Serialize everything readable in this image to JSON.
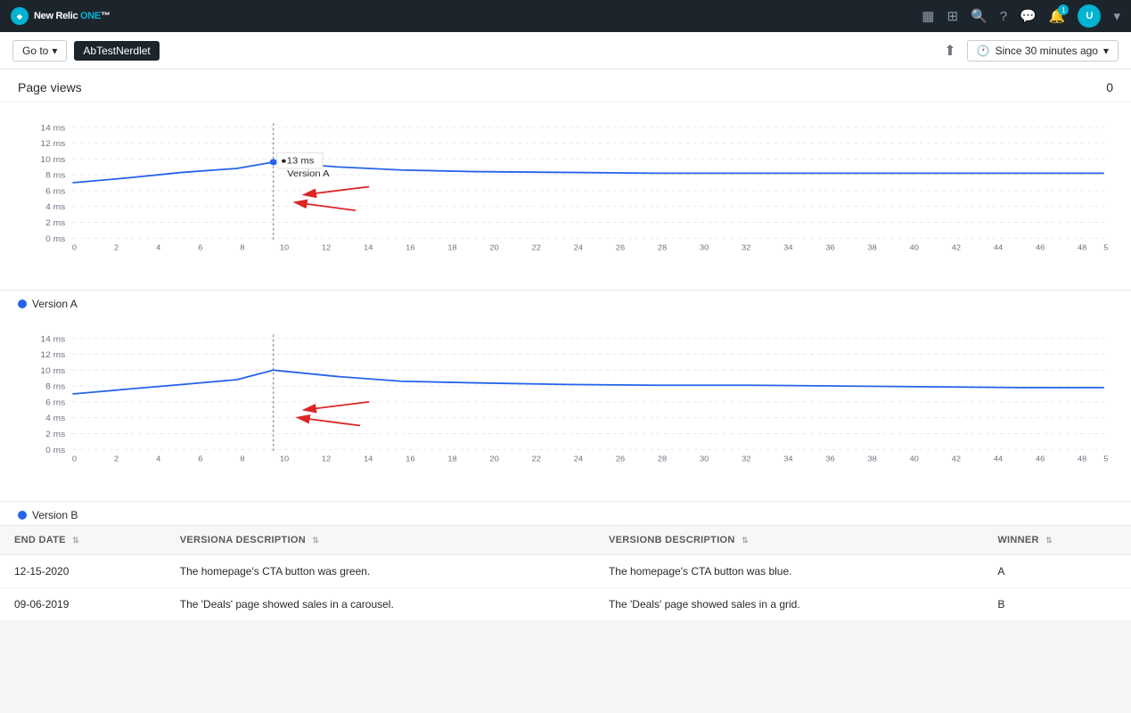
{
  "app": {
    "name": "New Relic ONE™"
  },
  "topnav": {
    "icons": [
      "chart-bar-icon",
      "grid-icon",
      "search-icon",
      "help-icon",
      "chat-icon",
      "bell-icon",
      "user-icon"
    ],
    "notification_count": "1",
    "user_initials": "U"
  },
  "breadcrumb": {
    "goto_label": "Go to",
    "goto_chevron": "▾",
    "nerdlet_label": "AbTestNerdlet",
    "share_icon": "↑",
    "time_icon": "🕐",
    "time_label": "Since 30 minutes ago",
    "time_chevron": "▾"
  },
  "pageviews": {
    "title": "Page views",
    "count": "0"
  },
  "chart1": {
    "legend_label": "Version A",
    "tooltip_value": "13 ms",
    "tooltip_label": "Version A",
    "y_labels": [
      "14 ms",
      "12 ms",
      "10 ms",
      "8 ms",
      "6 ms",
      "4 ms",
      "2 ms",
      "0 ms"
    ],
    "x_labels": [
      "0",
      "2",
      "4",
      "6",
      "8",
      "10",
      "12",
      "14",
      "16",
      "18",
      "20",
      "22",
      "24",
      "26",
      "28",
      "30",
      "32",
      "34",
      "36",
      "38",
      "40",
      "42",
      "44",
      "46",
      "48",
      "5"
    ]
  },
  "chart2": {
    "legend_label": "Version B",
    "y_labels": [
      "14 ms",
      "12 ms",
      "10 ms",
      "8 ms",
      "6 ms",
      "4 ms",
      "2 ms",
      "0 ms"
    ],
    "x_labels": [
      "0",
      "2",
      "4",
      "6",
      "8",
      "10",
      "12",
      "14",
      "16",
      "18",
      "20",
      "22",
      "24",
      "26",
      "28",
      "30",
      "32",
      "34",
      "36",
      "38",
      "40",
      "42",
      "44",
      "46",
      "48",
      "5"
    ]
  },
  "table": {
    "columns": [
      {
        "key": "end_date",
        "label": "END DATE"
      },
      {
        "key": "versiona_desc",
        "label": "VERSIONA DESCRIPTION"
      },
      {
        "key": "versionb_desc",
        "label": "VERSIONB DESCRIPTION"
      },
      {
        "key": "winner",
        "label": "WINNER"
      }
    ],
    "rows": [
      {
        "end_date": "12-15-2020",
        "versiona_desc": "The homepage's CTA button was green.",
        "versionb_desc": "The homepage's CTA button was blue.",
        "winner": "A"
      },
      {
        "end_date": "09-06-2019",
        "versiona_desc": "The 'Deals' page showed sales in a carousel.",
        "versionb_desc": "The 'Deals' page showed sales in a grid.",
        "winner": "B"
      }
    ]
  },
  "colors": {
    "version_a": "#2563eb",
    "version_b": "#2563eb",
    "legend_a": "#2563eb",
    "legend_b": "#2563eb",
    "arrow": "#dc2626",
    "grid": "#e5e7eb"
  }
}
